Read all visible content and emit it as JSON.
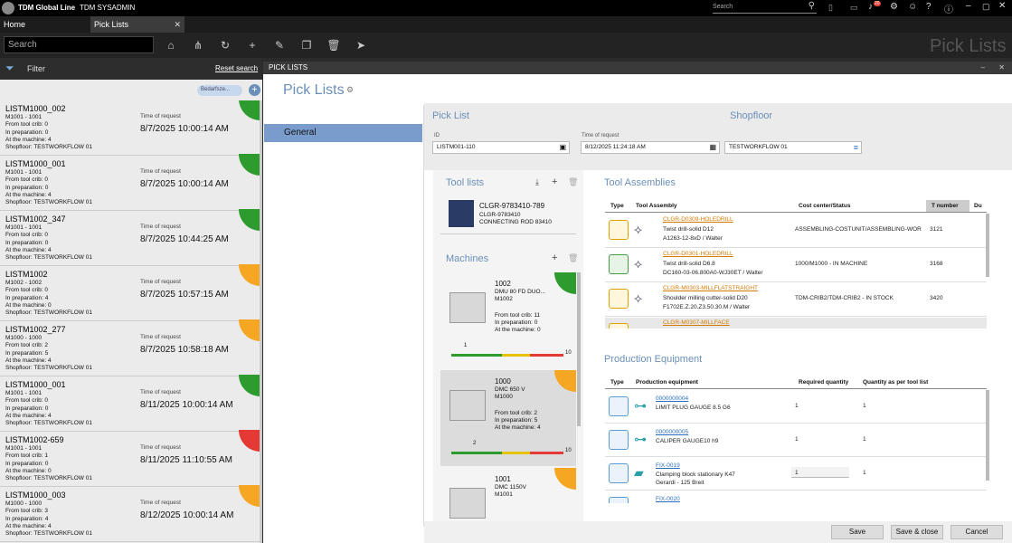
{
  "app": {
    "brand": "TDM Global Line",
    "user": "TDM SYSADMIN",
    "search_placeholder": "Search",
    "notif_count": "20"
  },
  "tabs": [
    {
      "label": "Home"
    },
    {
      "label": "Pick Lists"
    }
  ],
  "toolbar": {
    "search_placeholder": "Search",
    "page_title": "Pick Lists"
  },
  "filter": {
    "label": "Filter",
    "reset": "Reset search",
    "chip": "Bedarfsze..."
  },
  "labels": {
    "time_of_request": "Time of request",
    "from_crib": "From tool crib",
    "in_prep": "In preparation",
    "at_machine": "At the machine",
    "shopfloor": "Shopfloor"
  },
  "colors": {
    "green": "#2e9b2e",
    "orange": "#f5a623",
    "red": "#e53935",
    "accent": "#6a8fb9"
  },
  "picklists": [
    {
      "id": "LISTM1000_002",
      "machine": "M1001 - 1001",
      "from_crib": "From tool crib: 0",
      "in_prep": "In preparation: 0",
      "at_machine": "At the machine: 4",
      "shopfloor": "Shopfloor: TESTWORKFLOW 01",
      "time": "8/7/2025 10:00:14 AM",
      "status": "green"
    },
    {
      "id": "LISTM1000_001",
      "machine": "M1001 - 1001",
      "from_crib": "From tool crib: 0",
      "in_prep": "In preparation: 0",
      "at_machine": "At the machine: 4",
      "shopfloor": "Shopfloor: TESTWORKFLOW 01",
      "time": "8/7/2025 10:00:14 AM",
      "status": "green"
    },
    {
      "id": "LISTM1002_347",
      "machine": "M1001 - 1001",
      "from_crib": "From tool crib: 0",
      "in_prep": "In preparation: 0",
      "at_machine": "At the machine: 4",
      "shopfloor": "Shopfloor: TESTWORKFLOW 01",
      "time": "8/7/2025 10:44:25 AM",
      "status": "green"
    },
    {
      "id": "LISTM1002",
      "machine": "M1002 - 1002",
      "from_crib": "From tool crib: 0",
      "in_prep": "In preparation: 4",
      "at_machine": "At the machine: 0",
      "shopfloor": "Shopfloor: TESTWORKFLOW 01",
      "time": "8/7/2025 10:57:15 AM",
      "status": "orange"
    },
    {
      "id": "LISTM1002_277",
      "machine": "M1000 - 1000",
      "from_crib": "From tool crib: 2",
      "in_prep": "In preparation: 5",
      "at_machine": "At the machine: 4",
      "shopfloor": "Shopfloor: TESTWORKFLOW 01",
      "time": "8/7/2025 10:58:18 AM",
      "status": "orange"
    },
    {
      "id": "LISTM1000_001",
      "machine": "M1001 - 1001",
      "from_crib": "From tool crib: 0",
      "in_prep": "In preparation: 0",
      "at_machine": "At the machine: 4",
      "shopfloor": "Shopfloor: TESTWORKFLOW 01",
      "time": "8/11/2025 10:00:14 AM",
      "status": "green"
    },
    {
      "id": "LISTM1002-659",
      "machine": "M1001 - 1001",
      "from_crib": "From tool crib: 1",
      "in_prep": "In preparation: 0",
      "at_machine": "At the machine: 0",
      "shopfloor": "Shopfloor: TESTWORKFLOW 01",
      "time": "8/11/2025 11:10:55 AM",
      "status": "red"
    },
    {
      "id": "LISTM1000_003",
      "machine": "M1000 - 1000",
      "from_crib": "From tool crib: 3",
      "in_prep": "In preparation: 4",
      "at_machine": "At the machine: 4",
      "shopfloor": "Shopfloor: TESTWORKFLOW 01",
      "time": "8/12/2025 10:00:14 AM",
      "status": "orange"
    }
  ],
  "dialog": {
    "header": "PICK LISTS",
    "title": "Pick Lists",
    "nav_general": "General",
    "picklist_section": "Pick List",
    "shopfloor_section": "Shopfloor",
    "id_label": "ID",
    "id_value": "LISTM001-110",
    "time_label": "Time of request",
    "time_value": "8/12/2025 11:24:18 AM",
    "shopfloor_value": "TESTWORKFLOW 01",
    "toollists_title": "Tool lists",
    "toollist": {
      "id": "CLGR-9783410-789",
      "sub": "CLGR-9783410",
      "desc": "CONNECTING ROD 83410"
    },
    "machines_title": "Machines",
    "machines": [
      {
        "num": "1002",
        "name": "DMU 80 FD DUO...",
        "code": "M1002",
        "from_crib": "From tool crib: 11",
        "in_prep": "In preparation: 0",
        "at_machine": "At the machine: 0",
        "scale_marker": "1",
        "scale_max": "10",
        "status": "green"
      },
      {
        "num": "1000",
        "name": "DMC 650 V",
        "code": "M1000",
        "from_crib": "From tool crib: 2",
        "in_prep": "In preparation: 5",
        "at_machine": "At the machine: 4",
        "scale_marker": "2",
        "scale_max": "10",
        "status": "orange"
      },
      {
        "num": "1001",
        "name": "DMC 1150V",
        "code": "M1001",
        "status": "orange"
      }
    ],
    "assemblies_title": "Tool Assemblies",
    "assemblies_cols": [
      "Type",
      "Tool Assembly",
      "Cost center/Status",
      "T number",
      "Du"
    ],
    "assemblies": [
      {
        "code": "CLGR-D0309-HOLEDRILL",
        "desc": "Twist drill-solid D12",
        "sub": "A1263-12-8xD / Walter",
        "status": "ASSEMBLING-COSTUNIT/ASSEMBLING-WORKS...",
        "tnum": "3121"
      },
      {
        "code": "CLGR-D0301-HOLEDRILL",
        "desc": "Twist drill-solid D6.8",
        "sub": "DC160-03-06.800A0-WJ30ET / Walter",
        "status": "1000/M1000 - IN MACHINE",
        "tnum": "3168"
      },
      {
        "code": "CLGR-M0303-MILLFLATSTRAIGHT",
        "desc": "Shoulder milling cutter-solid D20",
        "sub": "F1702E.Z.20.Z3.50.30.M / Walter",
        "status": "TDM-CRIB2/TDM-CRIB2 - IN STOCK",
        "tnum": "3420"
      },
      {
        "code": "CLGR-M0307-MILLFACE",
        "desc": "",
        "sub": "",
        "status": "",
        "tnum": ""
      }
    ],
    "prodeq_title": "Production Equipment",
    "prodeq_cols": [
      "Type",
      "Production equipment",
      "Required quantity",
      "Quantity as per tool list"
    ],
    "prodeq": [
      {
        "code": "0000000004",
        "desc": "LIMIT PLUG GAUGE 8.5 G6",
        "sub": "",
        "req": "1",
        "qty": "1"
      },
      {
        "code": "0000000005",
        "desc": "CALIPER GAUGE10 h9",
        "sub": "",
        "req": "1",
        "qty": "1"
      },
      {
        "code": "FIX-0019",
        "desc": "Clamping block stationary K47",
        "sub": "Gerardi - 125 Breit",
        "req": "1",
        "qty": "1"
      },
      {
        "code": "FIX-0020",
        "desc": "",
        "sub": "",
        "req": "",
        "qty": ""
      }
    ],
    "buttons": {
      "save": "Save",
      "save_close": "Save & close",
      "cancel": "Cancel"
    }
  }
}
